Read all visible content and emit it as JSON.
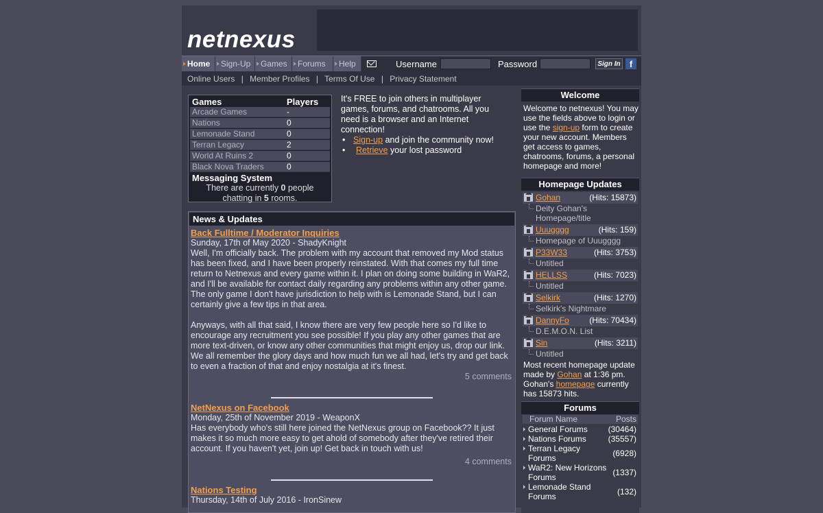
{
  "logo": "netnexus",
  "nav": {
    "tabs": [
      {
        "label": "Home",
        "active": true
      },
      {
        "label": "Sign-Up"
      },
      {
        "label": "Games"
      },
      {
        "label": "Forums"
      },
      {
        "label": "Help"
      }
    ],
    "mail_icon": "envelope-icon",
    "username_label": "Username",
    "password_label": "Password",
    "username_value": "",
    "password_value": "",
    "signin_label": "Sign In",
    "facebook_icon": "f"
  },
  "subnav": {
    "items": [
      "Online Users",
      "Member Profiles",
      "Terms Of Use",
      "Privacy Statement"
    ],
    "separator": "|"
  },
  "games_box": {
    "col_games": "Games",
    "col_players": "Players",
    "rows": [
      {
        "name": "Arcade Games",
        "players": "-"
      },
      {
        "name": "Nations",
        "players": "0"
      },
      {
        "name": "Lemonade Stand",
        "players": "0"
      },
      {
        "name": "Terran Legacy",
        "players": "2"
      },
      {
        "name": "World At Ruins 2",
        "players": "0"
      },
      {
        "name": "Black Nova Traders",
        "players": "0"
      }
    ],
    "messaging_title": "Messaging System",
    "messaging_pre": "There are currently ",
    "messaging_people": "0",
    "messaging_mid": " people chatting in ",
    "messaging_rooms": "5",
    "messaging_post": " rooms."
  },
  "intro": {
    "text": "It's FREE to join others in multiplayer games, forums, and chatrooms. All you need is a browser and an Internet connection!",
    "bullet1_link": "Sign-up",
    "bullet1_text": " and join the community now!",
    "bullet2_link": "Retrieve",
    "bullet2_text": " your lost password"
  },
  "news": {
    "heading": "News & Updates",
    "articles": [
      {
        "title": "Back Fulltime / Moderator Inquiries",
        "meta": "Sunday, 17th of May 2020 - ShadyKnight",
        "body1": "Well, I'm officially back. The problem with my account that removed my Mod status has been fixed, and I have been properly reinstated. With that comes my full time return to Netnexus and every game within it. I plan on doing some building in WaR2, and I'll be available for contact daily regarding any problems within any other game. The only game I don't have jurisdiction to help with is Lemonade Stand, but I can certainly give a few tips in that area.",
        "body2": "Anyways, with all that said, I know there are very few people here so I'd like to encourage any recruitment you see possible! If you play any other games that are more text-driven, or know any other communities that might enjoy us, drop our link. We all remember the glory days and how much fun we all had, let's try and get back to even a fraction of that and enjoy nostalgia at it's finest.",
        "comments": "5 comments"
      },
      {
        "title": "NetNexus on Facebook",
        "meta": "Monday, 25th of November 2019 - WeaponX",
        "body1": "Has everybody who's still here joined the NetNexus group on Facebook?? It just makes it so much more easy to get ahold of somebody after they've retired their account. If you haven't yet, join up! Get back in touch with us!",
        "comments": "4 comments"
      },
      {
        "title": "Nations Testing",
        "meta": "Thursday, 14th of July 2016 - IronSinew"
      }
    ]
  },
  "sidebar": {
    "welcome_head": "Welcome",
    "welcome_pre": "Welcome to netnexus! You may use the fields above to login or use the ",
    "welcome_link": "sign-up",
    "welcome_post": " form to create your new account. Members get access to games, chatrooms, forums, a personal homepage and more!",
    "homepage_head": "Homepage Updates",
    "homepages": [
      {
        "name": "Gohan",
        "hits": "(Hits: 15873)",
        "title": "Deity Gohan's Homepage/title"
      },
      {
        "name": "Uuugggg",
        "hits": "(Hits: 159)",
        "title": "Homepage of Uuugggg"
      },
      {
        "name": "P33W33",
        "hits": "(Hits: 3753)",
        "title": "Untitled"
      },
      {
        "name": "HELLSS",
        "hits": "(Hits: 7023)",
        "title": "Untitled"
      },
      {
        "name": "Selkirk",
        "hits": "(Hits: 1270)",
        "title": "Selkirk's Nightmare"
      },
      {
        "name": "DannyFo",
        "hits": "(Hits: 70434)",
        "title": "D.E.M.O.N. List"
      },
      {
        "name": "Sin",
        "hits": "(Hits: 3211)",
        "title": "Untitled"
      }
    ],
    "recent_pre": "Most recent homepage update made by ",
    "recent_user": "Gohan",
    "recent_mid": " at 1:36 pm. Gohan's ",
    "recent_link": "homepage",
    "recent_post": " currently has 15873 hits.",
    "forums_head": "Forums",
    "forums_col_name": "Forum Name",
    "forums_col_posts": "Posts",
    "forums": [
      {
        "name": "General Forums",
        "posts": "(30464)"
      },
      {
        "name": "Nations Forums",
        "posts": "(35557)"
      },
      {
        "name": "Terran Legacy Forums",
        "posts": "(6928)"
      },
      {
        "name": "WaR2: New Horizons Forums",
        "posts": "(1337)"
      },
      {
        "name": "Lemonade Stand Forums",
        "posts": "(132)"
      }
    ]
  }
}
